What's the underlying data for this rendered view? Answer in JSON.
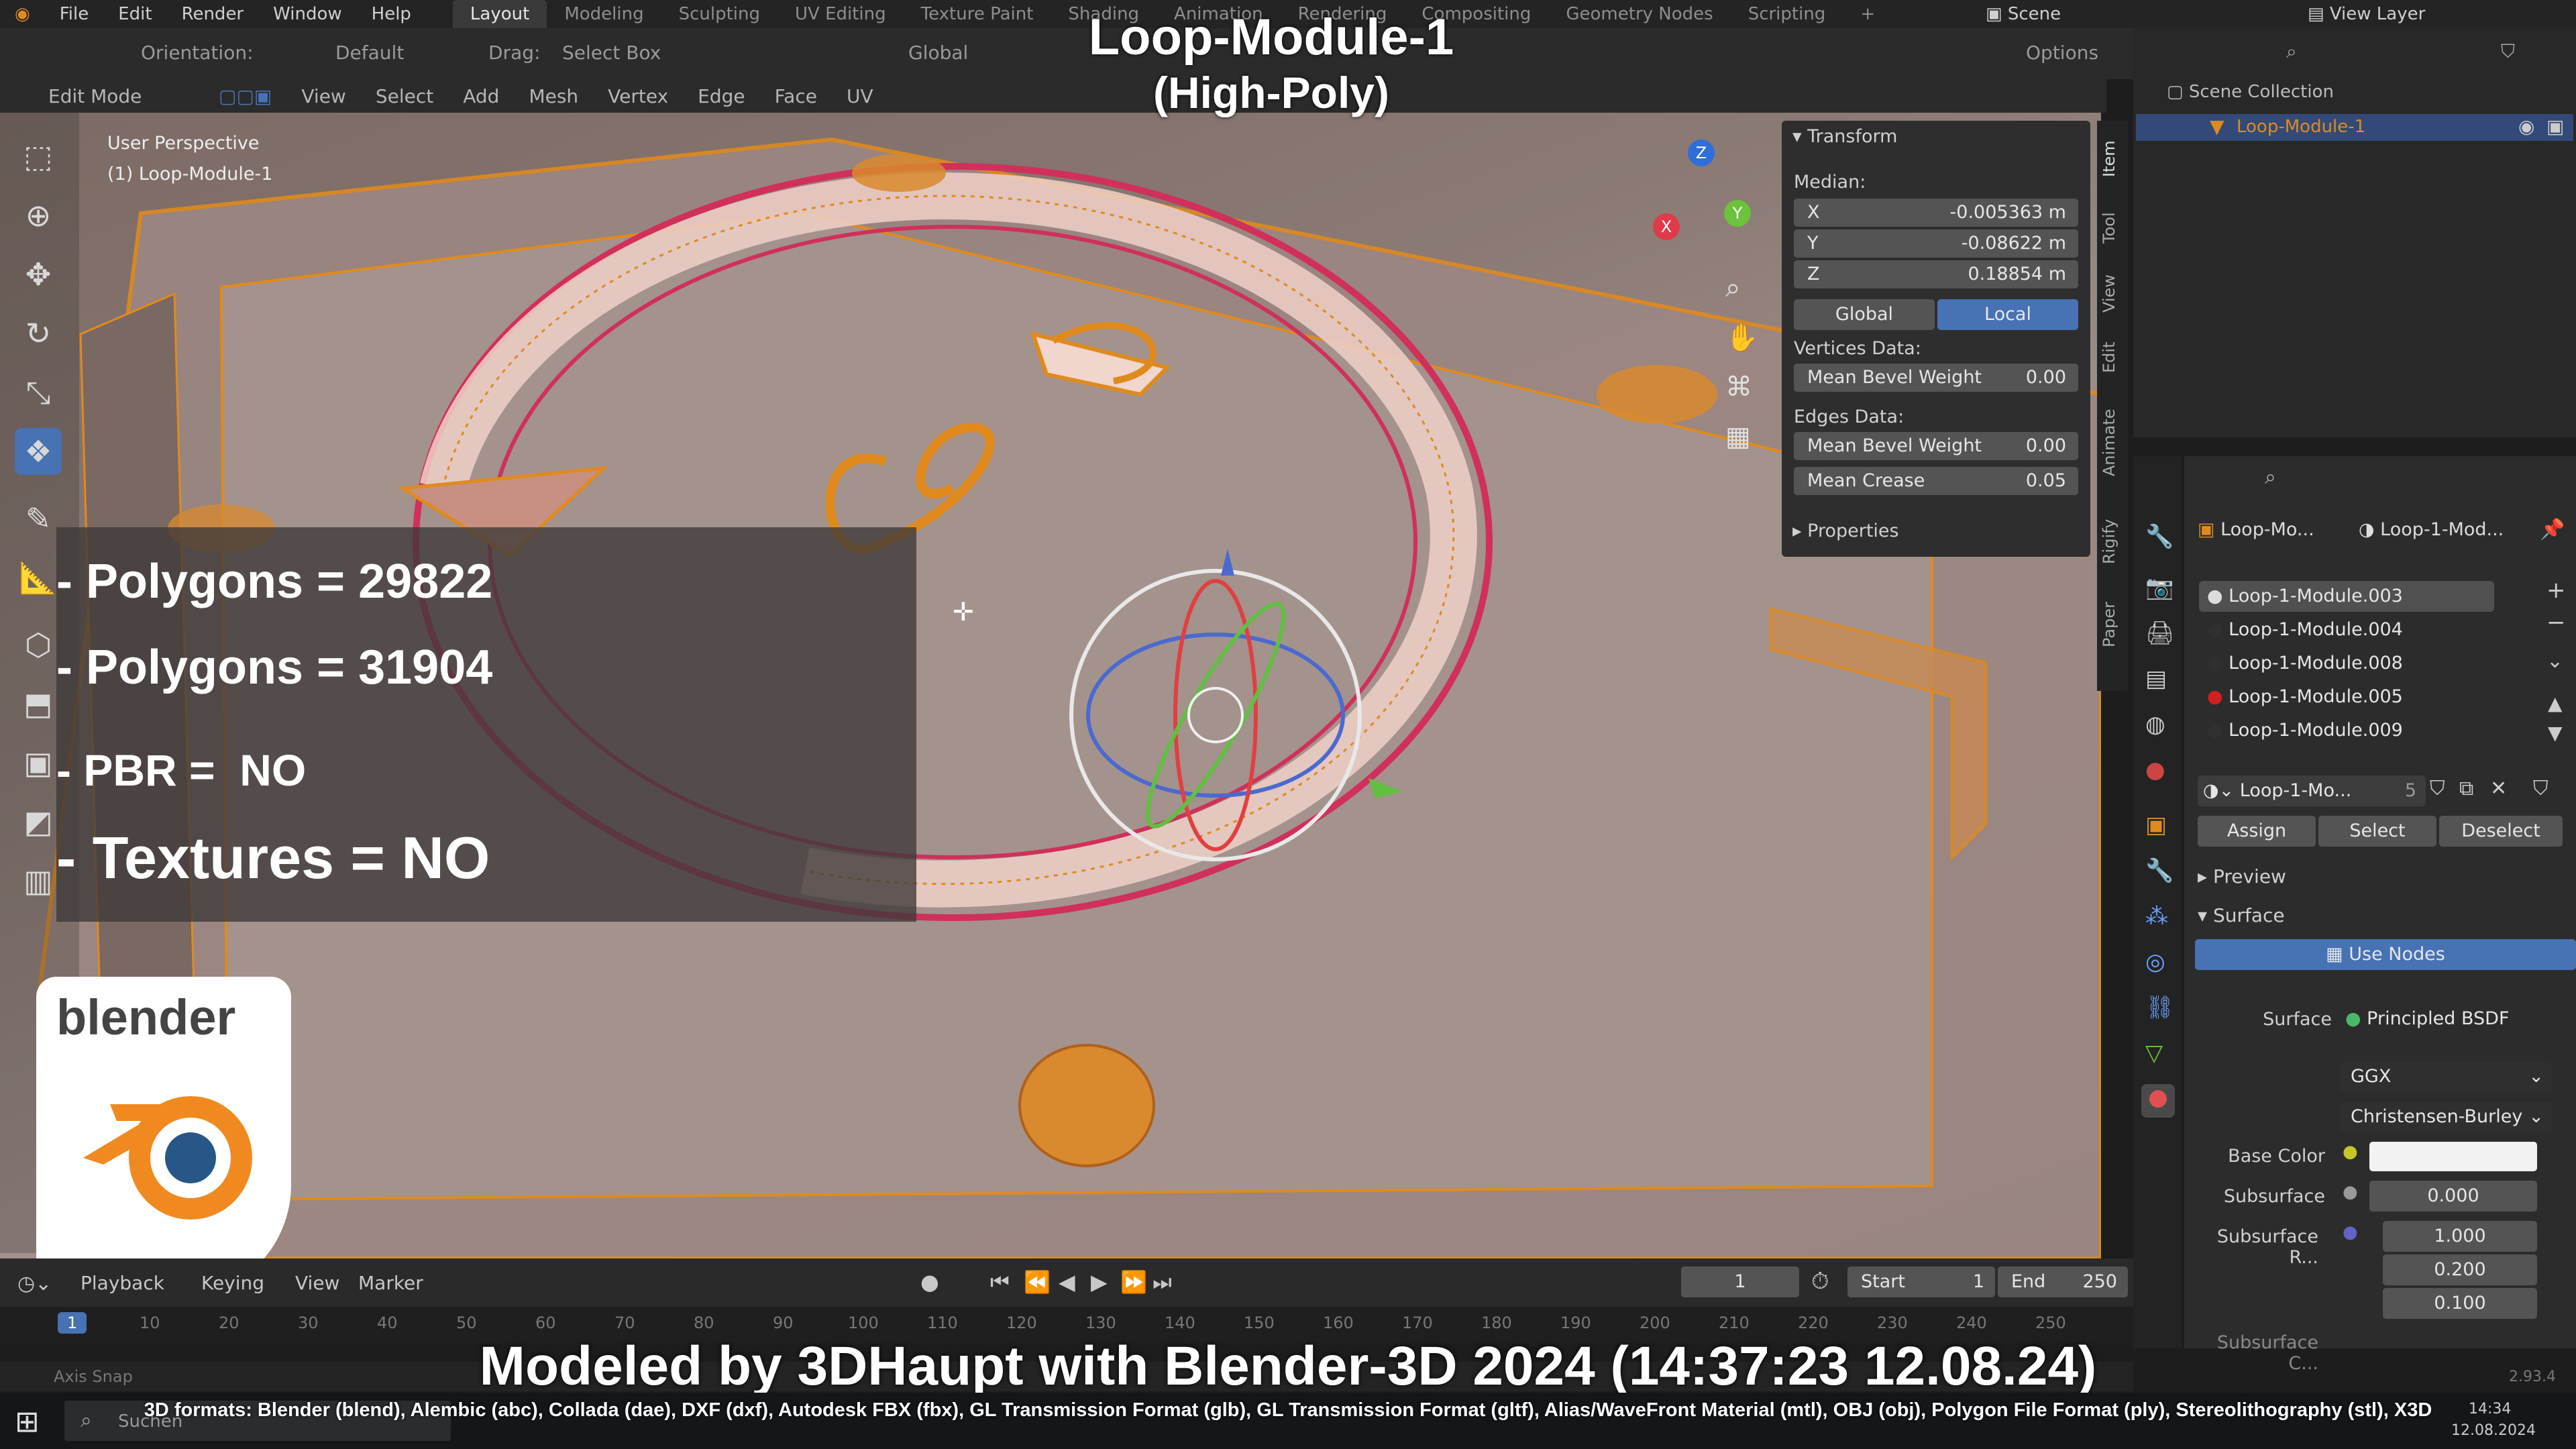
{
  "app": {
    "menu": [
      "File",
      "Edit",
      "Render",
      "Window",
      "Help"
    ],
    "workspaces": [
      "Layout",
      "Modeling",
      "Sculpting",
      "UV Editing",
      "Texture Paint",
      "Shading",
      "Animation",
      "Rendering",
      "Compositing",
      "Geometry Nodes",
      "Scripting"
    ],
    "scene": "Scene",
    "view_layer": "View Layer"
  },
  "tool_header": {
    "orientation_label": "Orientation:",
    "orientation_value": "Default",
    "drag_label": "Drag:",
    "drag_value": "Select Box",
    "transform_space": "Global",
    "options": "Options"
  },
  "mode_header": {
    "mode": "Edit Mode",
    "menus": [
      "View",
      "Select",
      "Add",
      "Mesh",
      "Vertex",
      "Edge",
      "Face",
      "UV"
    ]
  },
  "viewport": {
    "perspective": "User Perspective",
    "object": "(1) Loop-Module-1",
    "gizmo_axes": [
      "X",
      "Y",
      "Z"
    ]
  },
  "overlay": {
    "title": "Loop-Module-1",
    "subtitle": "(High-Poly)",
    "stats": [
      "- Polygons = 29822",
      "- Polygons = 31904",
      "- PBR =  NO",
      "- Textures = NO"
    ],
    "credit": "Modeled by 3DHaupt with Blender-3D 2024 (14:37:23  12.08.24)",
    "formats": "3D formats: Blender (blend), Alembic (abc), Collada (dae), DXF (dxf), Autodesk FBX (fbx), GL Transmission Format (glb), GL Transmission Format (gltf), Alias/WaveFront Material (mtl), OBJ (obj), Polygon File Format (ply), Stereolithography (stl), X3D",
    "logo_text": "blender"
  },
  "npanel": {
    "transform_header": "Transform",
    "median_label": "Median:",
    "median": [
      {
        "axis": "X",
        "value": "-0.005363 m"
      },
      {
        "axis": "Y",
        "value": "-0.08622 m"
      },
      {
        "axis": "Z",
        "value": "0.18854 m"
      }
    ],
    "space_buttons": [
      "Global",
      "Local"
    ],
    "active_space": "Local",
    "vertices_data_label": "Vertices Data:",
    "vertex_bevel": {
      "label": "Mean Bevel Weight",
      "value": "0.00"
    },
    "edges_data_label": "Edges Data:",
    "edge_bevel": {
      "label": "Mean Bevel Weight",
      "value": "0.00"
    },
    "edge_crease": {
      "label": "Mean Crease",
      "value": "0.05"
    },
    "properties_header": "Properties",
    "tabs": [
      "Item",
      "Tool",
      "View",
      "Edit",
      "Animate",
      "Rigify",
      "Paper"
    ]
  },
  "outliner": {
    "root": "Scene Collection",
    "item": "Loop-Module-1"
  },
  "properties": {
    "object_name": "Loop-Mo...",
    "material_name": "Loop-1-Mod...",
    "slots": [
      "Loop-1-Module.003",
      "Loop-1-Module.004",
      "Loop-1-Module.008",
      "Loop-1-Module.005",
      "Loop-1-Module.009"
    ],
    "slot_colors": [
      "#dddddd",
      "#303030",
      "#303030",
      "#d02020",
      "#303030"
    ],
    "active_material": "Loop-1-Mo...",
    "users": "5",
    "buttons": [
      "Assign",
      "Select",
      "Deselect"
    ],
    "preview": "Preview",
    "surface_header": "Surface",
    "use_nodes": "Use Nodes",
    "surface_label": "Surface",
    "surface_value": "Principled BSDF",
    "distribution": "GGX",
    "subsurface_method": "Christensen-Burley",
    "base_color_label": "Base Color",
    "subsurface_label": "Subsurface",
    "subsurface_value": "0.000",
    "subsurface_radius_label": "Subsurface R...",
    "subsurface_radius": [
      "1.000",
      "0.200",
      "0.100"
    ],
    "subsurface_color_label": "Subsurface C..."
  },
  "timeline": {
    "menus": [
      "Playback",
      "Keying",
      "View",
      "Marker"
    ],
    "current_frame": "1",
    "start_label": "Start",
    "start": "1",
    "end_label": "End",
    "end": "250",
    "ticks": [
      "1",
      "10",
      "20",
      "30",
      "40",
      "50",
      "60",
      "70",
      "80",
      "90",
      "100",
      "110",
      "120",
      "130",
      "140",
      "150",
      "160",
      "170",
      "180",
      "190",
      "200",
      "210",
      "220",
      "230",
      "240",
      "250"
    ]
  },
  "statusbar": {
    "left": "Axis Snap",
    "version": "2.93.4"
  },
  "taskbar": {
    "search": "Suchen",
    "time": "14:34",
    "date": "12.08.2024"
  },
  "colors": {
    "accent": "#4772b3",
    "mesh_orange": "#e08a1e",
    "seam_red": "#d0305a"
  }
}
